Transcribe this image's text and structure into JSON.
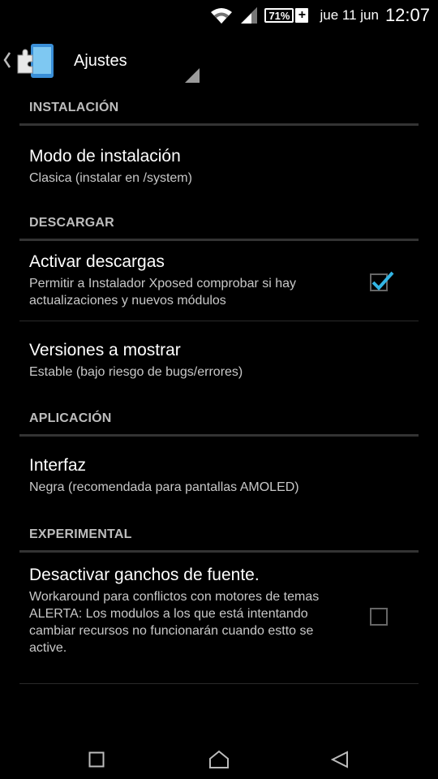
{
  "status_bar": {
    "battery_percent": "71%",
    "charging_symbol": "+",
    "date": "jue 11 jun",
    "time": "12:07",
    "icons": [
      "wifi-icon",
      "cell-signal-icon",
      "battery-icon",
      "charging-icon"
    ]
  },
  "action_bar": {
    "title": "Ajustes",
    "icon": "xposed-puzzle-icon"
  },
  "preferences": [
    {
      "category": "INSTALACIÓN"
    },
    {
      "title": "Modo de instalación",
      "summary": "Clasica (instalar en /system)"
    },
    {
      "category": "DESCARGAR"
    },
    {
      "title": "Activar descargas",
      "summary": "Permitir a Instalador Xposed comprobar si hay actualizaciones y nuevos módulos",
      "checked": true
    },
    {
      "title": "Versiones a mostrar",
      "summary": "Estable (bajo riesgo de bugs/errores)"
    },
    {
      "category": "APLICACIÓN"
    },
    {
      "title": "Interfaz",
      "summary": "Negra (recomendada para pantallas AMOLED)"
    },
    {
      "category": "EXPERIMENTAL"
    },
    {
      "title": "Desactivar ganchos de fuente.",
      "summary": "Workaround para conflictos con motores de temas\nALERTA: Los modulos a los que está intentando cambiar recursos no funcionarán cuando estto se active.",
      "checked": false
    }
  ],
  "nav_bar": {
    "buttons": [
      "recents-icon",
      "home-icon",
      "back-icon"
    ]
  },
  "colors": {
    "accent": "#33b5e5",
    "background": "#000000",
    "category_text": "#bdbdbd",
    "summary_text": "#c8c8c8"
  }
}
